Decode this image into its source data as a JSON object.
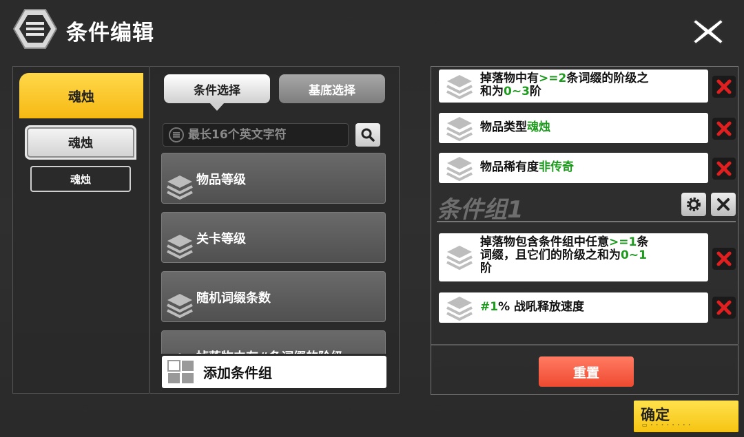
{
  "header": {
    "title": "条件编辑",
    "logo_icon": "hexagon-menu-icon",
    "close_icon": "close-icon"
  },
  "categories": {
    "selected": "魂烛",
    "sub_items": [
      "魂烛",
      "魂烛"
    ]
  },
  "tabs": [
    {
      "label": "条件选择",
      "active": true
    },
    {
      "label": "基底选择",
      "active": false
    }
  ],
  "search": {
    "placeholder": "最长16个英文字符",
    "icon": "search-icon"
  },
  "condition_list": [
    {
      "label": "物品等级"
    },
    {
      "label": "关卡等级"
    },
    {
      "label": "随机词缀条数"
    },
    {
      "label": "掉落物中有#条词缀的阶级"
    }
  ],
  "add_group": {
    "label": "添加条件组"
  },
  "rules": [
    {
      "parts": [
        "掉落物中有",
        ">=2",
        "条词缀的阶级之",
        "和为",
        "0~3",
        "阶"
      ]
    },
    {
      "parts": [
        "物品类型",
        "魂烛"
      ]
    },
    {
      "parts": [
        "物品稀有度",
        "非传奇"
      ]
    }
  ],
  "condition_group": {
    "title": "条件组1",
    "rules": [
      {
        "parts": [
          "掉落物包含条件组中任意",
          ">=1",
          "条",
          "词缀，且它们的阶级之和为",
          "0~1",
          "阶"
        ]
      },
      {
        "parts": [
          "#1",
          "% 战吼释放速度"
        ]
      }
    ]
  },
  "reset_label": "重置",
  "confirm_label": "确定",
  "colors": {
    "accent_yellow": "#f6b913",
    "highlight_green": "#1e9a1e",
    "reset_red": "#ef4a30",
    "delete_red": "#e02020"
  }
}
